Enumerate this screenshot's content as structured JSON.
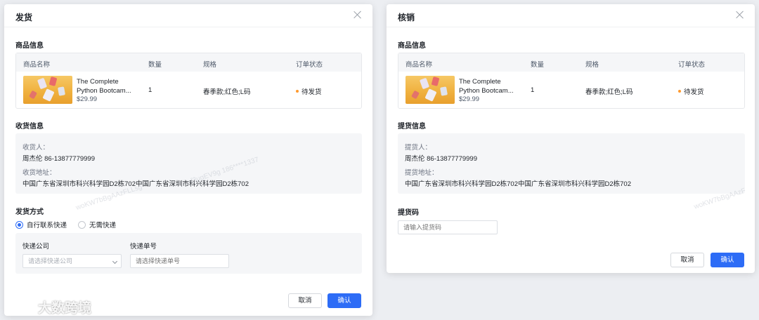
{
  "ship_modal": {
    "title": "发货",
    "goods_section": "商品信息",
    "goods_headers": [
      "商品名称",
      "数量",
      "规格",
      "订单状态"
    ],
    "goods": {
      "name": "The Complete Python Bootcam...",
      "name_line1": "The Complete",
      "name_line2": "Python Bootcam...",
      "price": "$29.99",
      "qty": "1",
      "spec": "春季款;红色;L码",
      "status": "待发货"
    },
    "recv_section": "收货信息",
    "recv_label": "收货人：",
    "recv_value": "周杰伦 86-13877779999",
    "addr_label": "收货地址：",
    "addr_value": "中国广东省深圳市科兴科学园D2栋702中国广东省深圳市科兴科学园D2栋702",
    "method_section": "发货方式",
    "method_options": [
      "自行联系快递",
      "无需快递"
    ],
    "method_selected": 0,
    "company_label": "快递公司",
    "company_placeholder": "请选择快递公司",
    "tracking_label": "快递单号",
    "tracking_placeholder": "请选择快递单号",
    "cancel": "取消",
    "ok": "确认"
  },
  "verify_modal": {
    "title": "核销",
    "goods_section": "商品信息",
    "goods_headers": [
      "商品名称",
      "数量",
      "规格",
      "订单状态"
    ],
    "goods": {
      "name_line1": "The Complete",
      "name_line2": "Python Bootcam...",
      "price": "$29.99",
      "qty": "1",
      "spec": "春季款;红色;L码",
      "status": "待发货"
    },
    "pick_section": "提货信息",
    "pick_label": "提货人：",
    "pick_value": "周杰伦 86-13877779999",
    "pick_addr_label": "提货地址：",
    "pick_addr_value": "中国广东省深圳市科兴科学园D2栋702中国广东省深圳市科兴科学园D2栋702",
    "code_section": "提货码",
    "code_placeholder": "请输入提货码",
    "cancel": "取消",
    "ok": "确认"
  },
  "watermarks": [
    "woKW7bBgAAzFLLsg",
    "-f3ugEV9g 186****1337",
    "woKW7bBgAAzF"
  ],
  "brand": "大数跨境",
  "colors": {
    "primary": "#2d6cf6",
    "status_dot": "#ff9a2e",
    "panel_bg": "#f5f6f8"
  }
}
